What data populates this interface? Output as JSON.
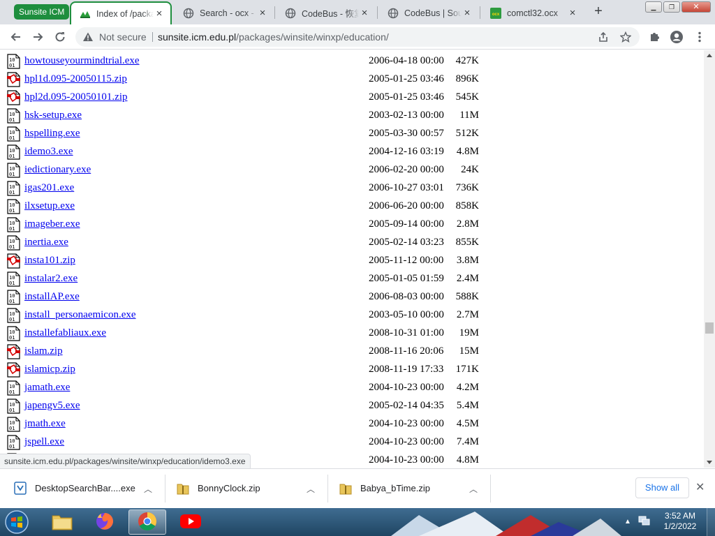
{
  "browser": {
    "tab_group_label": "Sunsite ICM",
    "tabs": [
      {
        "title": "Index of /packages/winsite/winxp/education",
        "favicon": "sunsite-favicon",
        "active": true
      },
      {
        "title": "Search - ocx - CodeBus",
        "favicon": "globe-icon",
        "active": false
      },
      {
        "title": "CodeBus - 恢复",
        "favicon": "globe-icon",
        "active": false
      },
      {
        "title": "CodeBus | Source Code",
        "favicon": "globe-icon",
        "active": false
      },
      {
        "title": "comctl32.ocx",
        "favicon": "ocx-favicon",
        "active": false
      }
    ],
    "new_tab": "+",
    "security_label": "Not secure",
    "url_host": "sunsite.icm.edu.pl",
    "url_path": "/packages/winsite/winxp/education/"
  },
  "listing": [
    {
      "name": "howtouseyourmindtrial.exe",
      "date": "2006-04-18 00:00",
      "size": "427K",
      "type": "binary"
    },
    {
      "name": "hpl1d.095-20050115.zip",
      "date": "2005-01-25 03:46",
      "size": "896K",
      "type": "compressed"
    },
    {
      "name": "hpl2d.095-20050101.zip",
      "date": "2005-01-25 03:46",
      "size": "545K",
      "type": "compressed"
    },
    {
      "name": "hsk-setup.exe",
      "date": "2003-02-13 00:00",
      "size": "11M",
      "type": "binary"
    },
    {
      "name": "hspelling.exe",
      "date": "2005-03-30 00:57",
      "size": "512K",
      "type": "binary"
    },
    {
      "name": "idemo3.exe",
      "date": "2004-12-16 03:19",
      "size": "4.8M",
      "type": "binary"
    },
    {
      "name": "iedictionary.exe",
      "date": "2006-02-20 00:00",
      "size": "24K",
      "type": "binary"
    },
    {
      "name": "igas201.exe",
      "date": "2006-10-27 03:01",
      "size": "736K",
      "type": "binary"
    },
    {
      "name": "ilxsetup.exe",
      "date": "2006-06-20 00:00",
      "size": "858K",
      "type": "binary"
    },
    {
      "name": "imageber.exe",
      "date": "2005-09-14 00:00",
      "size": "2.8M",
      "type": "binary"
    },
    {
      "name": "inertia.exe",
      "date": "2005-02-14 03:23",
      "size": "855K",
      "type": "binary"
    },
    {
      "name": "insta101.zip",
      "date": "2005-11-12 00:00",
      "size": "3.8M",
      "type": "compressed"
    },
    {
      "name": "instalar2.exe",
      "date": "2005-01-05 01:59",
      "size": "2.4M",
      "type": "binary"
    },
    {
      "name": "installAP.exe",
      "date": "2006-08-03 00:00",
      "size": "588K",
      "type": "binary"
    },
    {
      "name": "install_personaemicon.exe",
      "date": "2003-05-10 00:00",
      "size": "2.7M",
      "type": "binary"
    },
    {
      "name": "installefabliaux.exe",
      "date": "2008-10-31 01:00",
      "size": "19M",
      "type": "binary"
    },
    {
      "name": "islam.zip",
      "date": "2008-11-16 20:06",
      "size": "15M",
      "type": "compressed"
    },
    {
      "name": "islamicp.zip",
      "date": "2008-11-19 17:33",
      "size": "171K",
      "type": "compressed"
    },
    {
      "name": "jamath.exe",
      "date": "2004-10-23 00:00",
      "size": "4.2M",
      "type": "binary"
    },
    {
      "name": "japengv5.exe",
      "date": "2005-02-14 04:35",
      "size": "5.4M",
      "type": "binary"
    },
    {
      "name": "jmath.exe",
      "date": "2004-10-23 00:00",
      "size": "4.5M",
      "type": "binary"
    },
    {
      "name": "jspell.exe",
      "date": "2004-10-23 00:00",
      "size": "7.4M",
      "type": "binary"
    },
    {
      "name": "",
      "date": "2004-10-23 00:00",
      "size": "4.8M",
      "type": "binary"
    }
  ],
  "status_url": "sunsite.icm.edu.pl/packages/winsite/winxp/education/idemo3.exe",
  "downloads": {
    "items": [
      {
        "name": "DesktopSearchBar....exe",
        "icon": "exe-file-icon"
      },
      {
        "name": "BonnyClock.zip",
        "icon": "zip-file-icon"
      },
      {
        "name": "Babya_bTime.zip",
        "icon": "zip-file-icon"
      }
    ],
    "show_all": "Show all"
  },
  "taskbar": {
    "time": "3:52 AM",
    "date": "1/2/2022",
    "apps": [
      "windows-explorer-icon",
      "firefox-icon",
      "chrome-icon",
      "youtube-icon"
    ]
  },
  "colors": {
    "tab_group": "#1e8e3e",
    "link": "#0000ee",
    "accent_blue": "#1a73e8"
  }
}
